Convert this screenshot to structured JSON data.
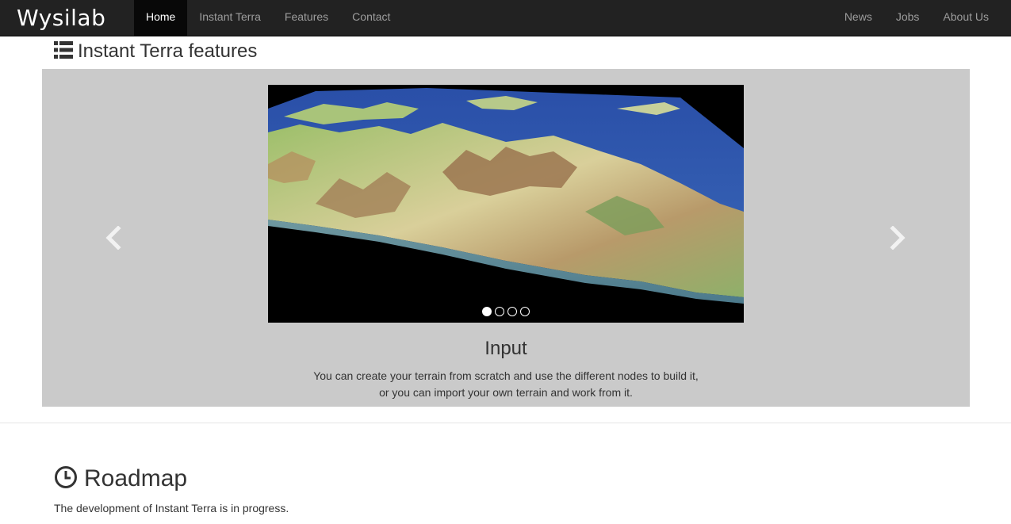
{
  "navbar": {
    "brand": "Wysilab",
    "left_items": [
      {
        "label": "Home",
        "active": true
      },
      {
        "label": "Instant Terra",
        "active": false
      },
      {
        "label": "Features",
        "active": false
      },
      {
        "label": "Contact",
        "active": false
      }
    ],
    "right_items": [
      {
        "label": "News"
      },
      {
        "label": "Jobs"
      },
      {
        "label": "About Us"
      }
    ]
  },
  "features": {
    "title": "Instant Terra features",
    "icon": "list-icon"
  },
  "carousel": {
    "slide_count": 4,
    "active_index": 0,
    "caption_title": "Input",
    "caption_line1": "You can create your terrain from scratch and use the different nodes to build it,",
    "caption_line2": "or you can import your own terrain and work from it.",
    "prev_icon": "chevron-left-icon",
    "next_icon": "chevron-right-icon"
  },
  "roadmap": {
    "title": "Roadmap",
    "icon": "clock-icon",
    "text": "The development of Instant Terra is in progress."
  },
  "colors": {
    "navbar_bg": "#222222",
    "nav_active_bg": "#080808",
    "nav_link": "#9d9d9d",
    "carousel_bg": "#cacaca",
    "text": "#333333"
  }
}
